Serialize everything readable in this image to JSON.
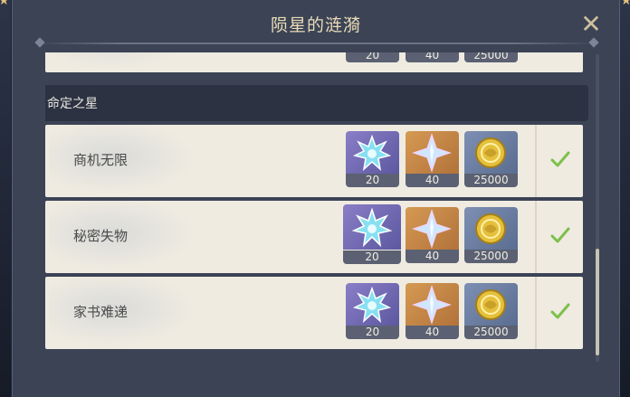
{
  "dialog": {
    "title": "陨星的涟漪",
    "close_icon": "✕"
  },
  "top_partial_row": {
    "items": [
      {
        "icon": "sparkle-crystal-icon",
        "count": "20"
      },
      {
        "icon": "star-gem-icon",
        "count": "40"
      },
      {
        "icon": "mora-coin-icon",
        "count": "25000"
      }
    ]
  },
  "section": {
    "title": "命定之星"
  },
  "rows": [
    {
      "name": "商机无限",
      "claimed": true,
      "items": [
        {
          "icon": "sparkle-crystal-icon",
          "count": "20"
        },
        {
          "icon": "star-gem-icon",
          "count": "40"
        },
        {
          "icon": "mora-coin-icon",
          "count": "25000"
        }
      ]
    },
    {
      "name": "秘密失物",
      "claimed": true,
      "items": [
        {
          "icon": "sparkle-crystal-icon",
          "count": "20"
        },
        {
          "icon": "star-gem-icon",
          "count": "40"
        },
        {
          "icon": "mora-coin-icon",
          "count": "25000"
        }
      ]
    },
    {
      "name": "家书难递",
      "claimed": true,
      "items": [
        {
          "icon": "sparkle-crystal-icon",
          "count": "20"
        },
        {
          "icon": "star-gem-icon",
          "count": "40"
        },
        {
          "icon": "mora-coin-icon",
          "count": "25000"
        }
      ]
    }
  ],
  "colors": {
    "panel": "#3b4355",
    "row_bg": "#efebe1",
    "purple_tile": "#7b70bc",
    "orange_tile": "#c98a47",
    "blue_tile": "#6c7fa5",
    "check_green": "#7cc04a",
    "title_text": "#eadcb8"
  }
}
